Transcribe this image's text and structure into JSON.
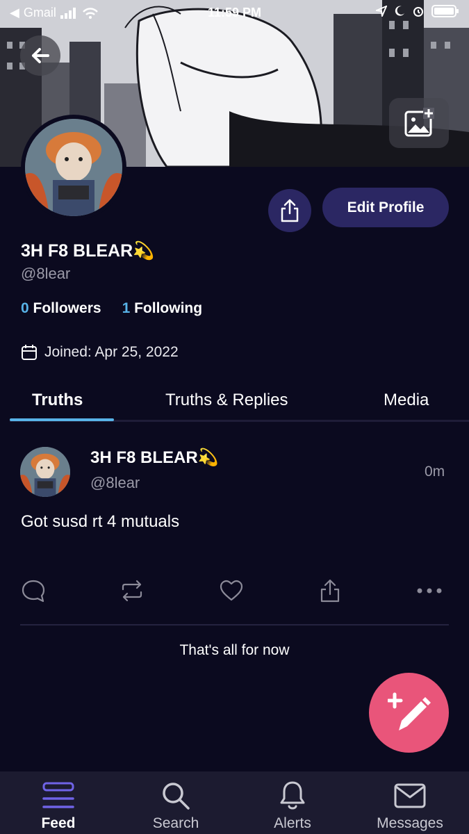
{
  "status_bar": {
    "back_app": "Gmail",
    "time": "11:59 PM"
  },
  "profile": {
    "display_name": "3H F8 BLEAR💫",
    "handle": "@8lear",
    "followers_count": "0",
    "followers_label": "Followers",
    "following_count": "1",
    "following_label": "Following",
    "joined": "Joined: Apr 25, 2022",
    "edit_profile_label": "Edit Profile"
  },
  "tabs": [
    {
      "label": "Truths",
      "active": true
    },
    {
      "label": "Truths & Replies",
      "active": false
    },
    {
      "label": "Media",
      "active": false
    }
  ],
  "post": {
    "author": "3H F8 BLEAR💫",
    "handle": "@8lear",
    "time": "0m",
    "text": "Got susd rt 4 mutuals"
  },
  "feed_end_text": "That's all for now",
  "bottom_nav": [
    {
      "label": "Feed",
      "icon": "feed-icon",
      "active": true
    },
    {
      "label": "Search",
      "icon": "search-icon",
      "active": false
    },
    {
      "label": "Alerts",
      "icon": "bell-icon",
      "active": false
    },
    {
      "label": "Messages",
      "icon": "mail-icon",
      "active": false
    }
  ],
  "colors": {
    "background": "#0b0a1f",
    "accent_blue": "#58b3e8",
    "button_purple": "#2b2763",
    "fab_pink": "#e9557a",
    "nav_bg": "#1c1b30",
    "active_nav_icon": "#6f63e6"
  }
}
